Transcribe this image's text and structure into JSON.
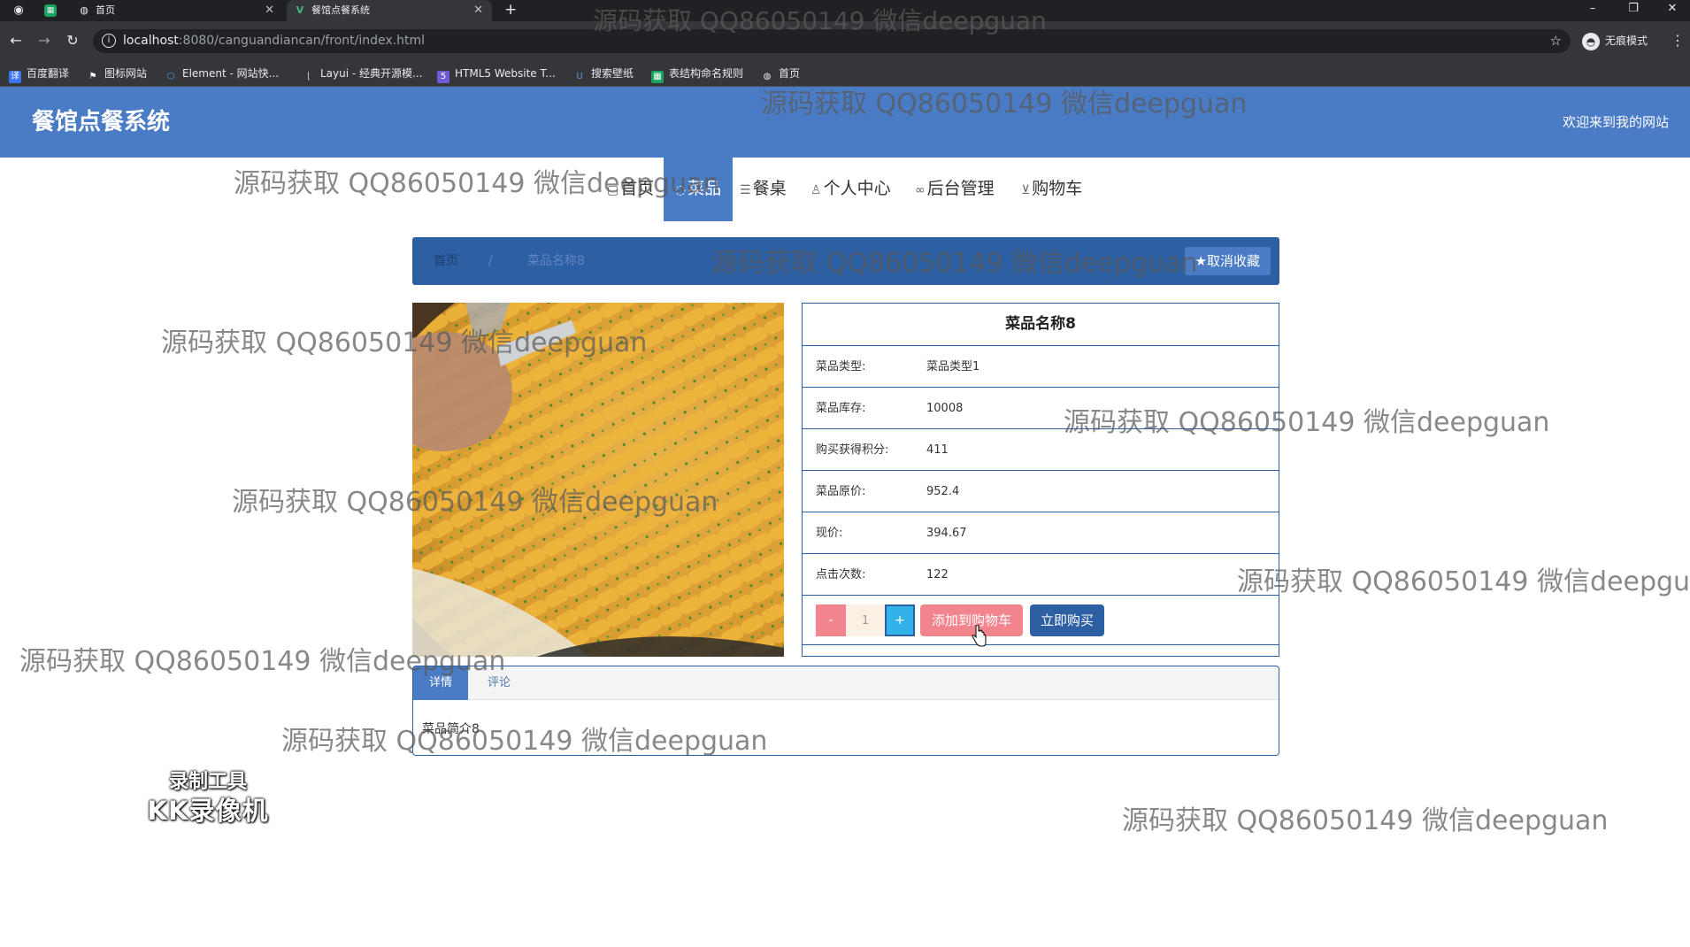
{
  "browser": {
    "tabs": [
      {
        "title": "首页",
        "icon": "globe-icon"
      },
      {
        "title": "餐馆点餐系统",
        "icon": "vue-icon"
      }
    ],
    "url_host": "localhost",
    "url_rest": ":8080/canguandiancan/front/index.html",
    "incognito_label": "无痕模式",
    "bookmarks": [
      {
        "label": "百度翻译",
        "icon": "translate-icon",
        "color": "#3b74f0"
      },
      {
        "label": "图标网站",
        "icon": "flag-icon",
        "color": "#ffffff"
      },
      {
        "label": "Element - 网站快...",
        "icon": "element-icon",
        "color": "#409eff"
      },
      {
        "label": "Layui - 经典开源模...",
        "icon": "layui-icon",
        "color": "#cccccc"
      },
      {
        "label": "HTML5 Website T...",
        "icon": "html5-icon",
        "color": "#6f5bd3"
      },
      {
        "label": "搜索壁纸",
        "icon": "wallpaper-icon",
        "color": "#3b6fd6"
      },
      {
        "label": "表结构命名规则",
        "icon": "sheet-icon",
        "color": "#1aa260"
      },
      {
        "label": "首页",
        "icon": "globe-icon",
        "color": "#e8eaed"
      }
    ]
  },
  "site": {
    "title": "餐馆点餐系统",
    "welcome": "欢迎来到我的网站",
    "brand_color": "#4a7bc5",
    "nav": [
      {
        "label": "首页",
        "icon": "home-icon",
        "active": false
      },
      {
        "label": "菜品",
        "icon": "food-icon",
        "active": true
      },
      {
        "label": "餐桌",
        "icon": "layers-icon",
        "active": false
      },
      {
        "label": "个人中心",
        "icon": "user-icon",
        "active": false
      },
      {
        "label": "后台管理",
        "icon": "link-icon",
        "active": false
      },
      {
        "label": "购物车",
        "icon": "cart-icon",
        "active": false
      }
    ]
  },
  "breadcrumb": {
    "home": "首页",
    "separator": "/",
    "current": "菜品名称8",
    "fav_button": "取消收藏"
  },
  "detail": {
    "name": "菜品名称8",
    "fields": [
      {
        "label": "菜品类型:",
        "value": "菜品类型1"
      },
      {
        "label": "菜品库存:",
        "value": "10008"
      },
      {
        "label": "购买获得积分:",
        "value": "411"
      },
      {
        "label": "菜品原价:",
        "value": "952.4"
      },
      {
        "label": "现价:",
        "value": "394.67"
      },
      {
        "label": "点击次数:",
        "value": "122"
      }
    ],
    "quantity": "1",
    "minus_label": "-",
    "plus_label": "+",
    "add_cart_label": "添加到购物车",
    "buy_now_label": "立即购买"
  },
  "content_tabs": {
    "tabs": [
      {
        "label": "详情",
        "active": true
      },
      {
        "label": "评论",
        "active": false
      }
    ],
    "detail_text": "菜品简介8"
  },
  "overlay": {
    "recorder_line1": "录制工具",
    "recorder_line2": "KK录像机",
    "watermark": "源码获取 QQ86050149 微信deepguan"
  }
}
